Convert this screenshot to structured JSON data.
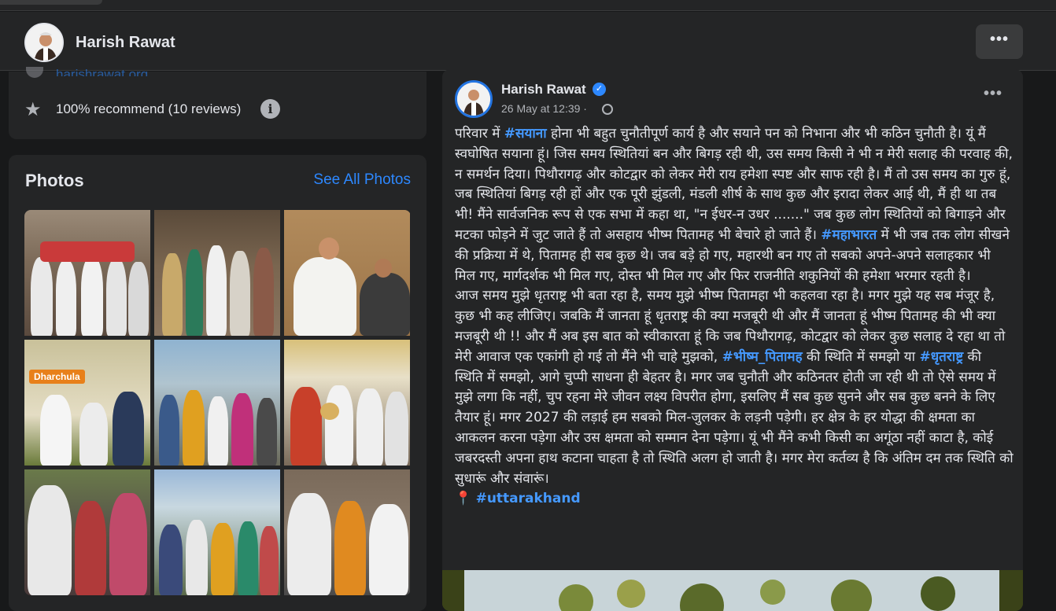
{
  "header": {
    "page_name": "Harish Rawat",
    "more_button": "•••"
  },
  "intro": {
    "website": "harishrawat.org",
    "recommend": "100% recommend (10 reviews)",
    "info_icon": "i"
  },
  "photos": {
    "title": "Photos",
    "see_all": "See All Photos",
    "photo4_tag": "Dharchula"
  },
  "post": {
    "author": "Harish Rawat",
    "date": "26 May at 12:39 ·",
    "more": "•••",
    "para1_a": "परिवार में ",
    "tag1": "#सयाना",
    "para1_b": " होना भी बहुत चुनौतीपूर्ण कार्य है और सयाने पन को निभाना और भी कठिन चुनौती है। यूं मैं स्वघोषित सयाना हूं। जिस समय स्थितियां बन और बिगड़ रही थी, उस समय किसी ने भी न मेरी सलाह की परवाह की, न समर्थन दिया। पिथौरागढ़ और कोटद्वार को लेकर मेरी राय हमेशा स्पष्ट और साफ रही है। मैं तो उस समय का गुरु हूं, जब स्थितियां बिगड़ रही हों और एक पूरी झुंडली, मंडली शीर्ष के साथ कुछ और इरादा लेकर आई थी, मैं ही था तब भी! मैंने सार्वजनिक रूप से एक सभा में कहा था, \"न ईधर-न उधर .......\" जब कुछ लोग स्थितियों को बिगाड़ने और मटका फोड़ने में जुट जाते हैं तो असहाय भीष्म पितामह भी बेचारे हो जाते हैं। ",
    "tag2": "#महाभारत",
    "para1_c": " में भी जब तक लोग सीखने की प्रक्रिया में थे, पितामह ही सब कुछ थे। जब बड़े हो गए, महारथी बन गए तो सबको अपने-अपने सलाहकार भी मिल गए, मार्गदर्शक भी मिल गए, दोस्त भी मिल गए और फिर राजनीति शकुनियों की हमेशा भरमार रहती है।",
    "para2_a": "आज समय मुझे धृतराष्ट्र भी बता रहा है, समय मुझे भीष्म पितामहा भी कहलवा रहा है। मगर मुझे यह सब मंजूर है, कुछ भी कह लीजिए। जबकि मैं जानता हूं धृतराष्ट्र की क्या मजबूरी थी और मैं जानता हूं भीष्म पितामह की भी क्या मजबूरी थी !! और मैं अब इस बात को स्वीकारता हूं कि जब पिथौरागढ़, कोटद्वार को लेकर कुछ सलाह दे रहा था तो मेरी आवाज एक एकांगी हो गई तो मैंने भी चाहे मुझको, ",
    "tag3": "#भीष्म_पितामह",
    "para2_b": " की स्थिति में समझो या ",
    "tag4": "#धृतराष्ट्र",
    "para2_c": " की स्थिति में समझो, आगे चुप्पी साधना ही बेहतर है। मगर जब चुनौती और कठिनतर होती जा रही थी तो ऐसे समय में मुझे लगा कि नहीं, चुप रहना मेरे जीवन लक्ष्य विपरीत होगा, इसलिए मैं सब कुछ सुनने और सब कुछ बनने के लिए तैयार हूं। मगर 2027 की लड़ाई हम सबको मिल-जुलकर के लड़नी पड़ेगी। हर क्षेत्र के हर योद्धा की क्षमता का आकलन करना पड़ेगा और उस क्षमता को सम्मान देना पड़ेगा। यूं भी मैंने कभी किसी का अगूंठा नहीं काटा है, कोई जबरदस्ती अपना हाथ कटाना चाहता है तो स्थिति अलग हो जाती है। मगर मेरा कर्तव्य है कि अंतिम दम तक स्थिति को सुधारूं और संवारूं।",
    "pin_icon": "📍",
    "tag5": "#uttarakhand"
  }
}
